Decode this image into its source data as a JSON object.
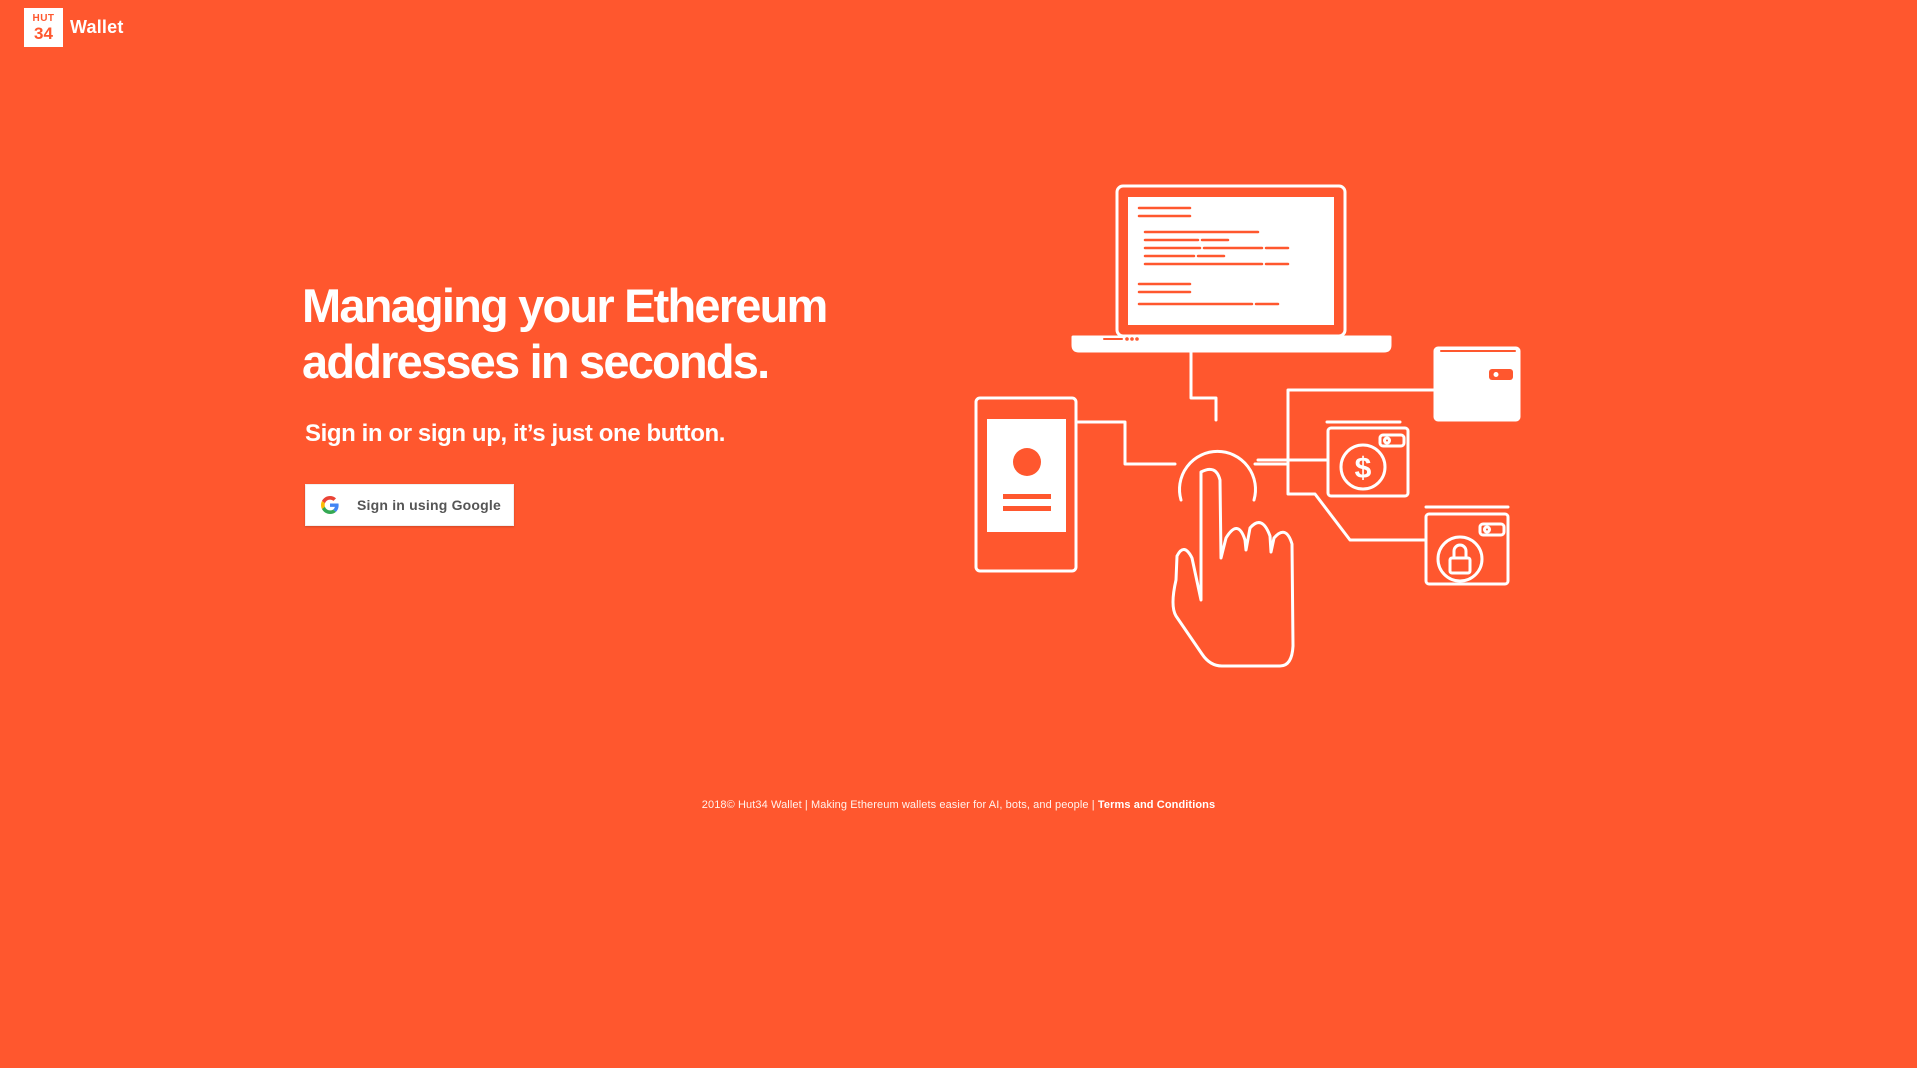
{
  "header": {
    "logo_line1": "HUT",
    "logo_line2": "34",
    "brand_name": "Wallet"
  },
  "hero": {
    "headline_line1": "Managing your Ethereum",
    "headline_line2": "addresses in seconds.",
    "subline": "Sign in or sign up, it’s just one button."
  },
  "signin": {
    "label": "Sign in using Google",
    "icon": "google-icon"
  },
  "illustration": {
    "icons": [
      "laptop-icon",
      "phone-icon",
      "touch-hand-icon",
      "wallet-icon",
      "dollar-wallet-icon",
      "lock-wallet-icon"
    ]
  },
  "footer": {
    "text": "2018© Hut34 Wallet | Making Ethereum wallets easier for AI, bots, and people | ",
    "terms_link": "Terms and Conditions"
  },
  "colors": {
    "background": "#FF572E",
    "foreground": "#FFFFFF",
    "button_text": "#555555"
  }
}
